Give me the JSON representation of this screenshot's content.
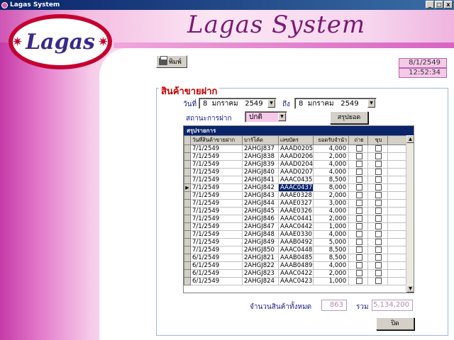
{
  "window": {
    "title": "Lagas System",
    "buttons": [
      "_",
      "□",
      "x"
    ]
  },
  "header": {
    "title": "Lagas System",
    "logo_text": "Lagas"
  },
  "status": {
    "date": "8/1/2549",
    "time": "12:52:34"
  },
  "toolbar": {
    "print_label": "พิมพ์"
  },
  "section": {
    "title": "สินค้าขายฝาก"
  },
  "filters": {
    "date_label": "วันที่",
    "date_from": {
      "day": "8",
      "month": "มกราคม",
      "year": "2549"
    },
    "to_label": "ถึง",
    "date_to": {
      "day": "8",
      "month": "มกราคม",
      "year": "2549"
    },
    "status_label": "สถานะการฝาก",
    "status_value": "ปกติ",
    "summary_button": "สรุปยอด"
  },
  "grid": {
    "caption": "สรุปรายการ",
    "columns": [
      "วันที่สินค้าขายฝาก",
      "บาร์โค้ด",
      "เลขบัตร",
      "ยอดรับจำนำ",
      "ถ่าย",
      "ขุบ"
    ],
    "selected_row": 5,
    "rows": [
      [
        "7/1/2549",
        "2AHGJ837",
        "AAAD0205",
        "4,000"
      ],
      [
        "7/1/2549",
        "2AHGJ838",
        "AAAD0206",
        "2,000"
      ],
      [
        "7/1/2549",
        "2AHGJ839",
        "AAAD0204",
        "4,000"
      ],
      [
        "7/1/2549",
        "2AHGJ840",
        "AAAD0207",
        "4,000"
      ],
      [
        "7/1/2549",
        "2AHGJ841",
        "AAAC0435",
        "8,500"
      ],
      [
        "7/1/2549",
        "2AHGJ842",
        "AAAC0437",
        "8,000"
      ],
      [
        "7/1/2549",
        "2AHGJ843",
        "AAAE0328",
        "2,000"
      ],
      [
        "7/1/2549",
        "2AHGJ844",
        "AAAE0327",
        "3,000"
      ],
      [
        "7/1/2549",
        "2AHGJ845",
        "AAAE0326",
        "4,000"
      ],
      [
        "7/1/2549",
        "2AHGJ846",
        "AAAC0441",
        "2,000"
      ],
      [
        "7/1/2549",
        "2AHGJ847",
        "AAAC0442",
        "1,000"
      ],
      [
        "7/1/2549",
        "2AHGJ848",
        "AAAE0330",
        "4,000"
      ],
      [
        "7/1/2549",
        "2AHGJ849",
        "AAAB0492",
        "5,000"
      ],
      [
        "7/1/2549",
        "2AHGJ850",
        "AAAC0448",
        "8,500"
      ],
      [
        "6/1/2549",
        "2AHGJ821",
        "AAAB0485",
        "8,500"
      ],
      [
        "6/1/2549",
        "2AHGJ822",
        "AAAB0489",
        "4,000"
      ],
      [
        "6/1/2549",
        "2AHGJ823",
        "AAAC0422",
        "2,000"
      ],
      [
        "6/1/2549",
        "2AHGJ824",
        "AAAC0423",
        "1,000"
      ]
    ]
  },
  "totals": {
    "count_label": "จำนวนสินค้าทั้งหมด",
    "count_value": "863",
    "sum_label": "รวม",
    "sum_value": "5,134,200"
  },
  "close_button": "ปิด",
  "icons": [
    "app-icon",
    "printer-icon",
    "dropdown-arrow-icon",
    "row-pointer-icon",
    "scroll-up-icon",
    "scroll-down-icon"
  ]
}
